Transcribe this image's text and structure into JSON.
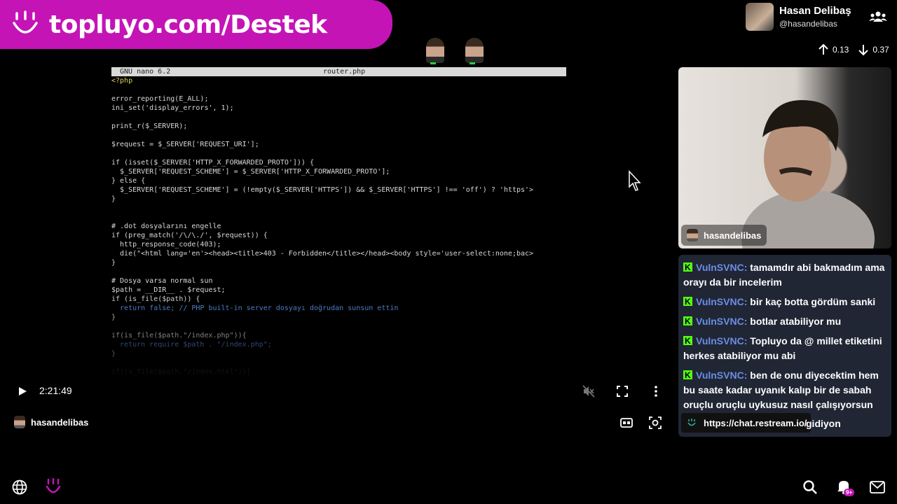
{
  "banner": {
    "text": "topluyo.com/Destek"
  },
  "terminal": {
    "editor": "GNU nano 6.2",
    "filename": "router.php",
    "lines": [
      {
        "t": "<?php",
        "c": "str"
      },
      {
        "t": "",
        "c": ""
      },
      {
        "t": "error_reporting(E_ALL);",
        "c": ""
      },
      {
        "t": "ini_set('display_errors', 1);",
        "c": ""
      },
      {
        "t": "",
        "c": ""
      },
      {
        "t": "print_r($_SERVER);",
        "c": ""
      },
      {
        "t": "",
        "c": ""
      },
      {
        "t": "$request = $_SERVER['REQUEST_URI'];",
        "c": ""
      },
      {
        "t": "",
        "c": ""
      },
      {
        "t": "if (isset($_SERVER['HTTP_X_FORWARDED_PROTO'])) {",
        "c": ""
      },
      {
        "t": "  $_SERVER['REQUEST_SCHEME'] = $_SERVER['HTTP_X_FORWARDED_PROTO'];",
        "c": ""
      },
      {
        "t": "} else {",
        "c": ""
      },
      {
        "t": "  $_SERVER['REQUEST_SCHEME'] = (!empty($_SERVER['HTTPS']) && $_SERVER['HTTPS'] !== 'off') ? 'https'>",
        "c": ""
      },
      {
        "t": "}",
        "c": ""
      },
      {
        "t": "",
        "c": ""
      },
      {
        "t": "",
        "c": ""
      },
      {
        "t": "# .dot dosyalarını engelle",
        "c": ""
      },
      {
        "t": "if (preg_match('/\\/\\./', $request)) {",
        "c": ""
      },
      {
        "t": "  http_response_code(403);",
        "c": ""
      },
      {
        "t": "  die(\"<html lang='en'><head><title>403 - Forbidden</title></head><body style='user-select:none;bac>",
        "c": ""
      },
      {
        "t": "}",
        "c": ""
      },
      {
        "t": "",
        "c": ""
      },
      {
        "t": "# Dosya varsa normal sun",
        "c": ""
      },
      {
        "t": "$path = __DIR__ . $request;",
        "c": ""
      },
      {
        "t": "if (is_file($path)) {",
        "c": ""
      },
      {
        "t": "  return false; // PHP built-in server dosyayı doğrudan sunsun ettin",
        "c": "kw"
      },
      {
        "t": "}",
        "c": ""
      },
      {
        "t": "",
        "c": ""
      },
      {
        "t": "if(is_file($path.\"/index.php\")){",
        "c": ""
      },
      {
        "t": "  return require $path . \"/index.php\";",
        "c": "kw"
      },
      {
        "t": "}",
        "c": ""
      },
      {
        "t": "",
        "c": ""
      },
      {
        "t": "if(is_file($path.\"/index.html\")){",
        "c": "dim"
      }
    ]
  },
  "player": {
    "time": "2:21:49",
    "channel": "hasandelibas"
  },
  "profile": {
    "name": "Hasan Delibaş",
    "handle": "@hasandelibas"
  },
  "stats": {
    "up": "0.13",
    "down": "0.37"
  },
  "cam": {
    "label": "hasandelibas"
  },
  "chat": {
    "messages": [
      {
        "user": "VulnSVNC:",
        "text": " tamamdır abi bakmadım ama orayı da bir incelerim"
      },
      {
        "user": "VulnSVNC:",
        "text": " bir kaç botta gördüm sanki"
      },
      {
        "user": "VulnSVNC:",
        "text": " botlar atabiliyor mu"
      },
      {
        "user": "VulnSVNC:",
        "text": " Topluyo da @ millet etiketini herkes atabiliyor mu abi"
      },
      {
        "user": "VulnSVNC:",
        "text": " ben de onu diyecektim hem bu saate kadar uyanık kalıp bir de sabah oruçlu oruçlu uykusuz nasıl çalışıyorsun"
      }
    ],
    "url": "https://chat.restream.io/",
    "tail": "gidiyon"
  },
  "notifications": {
    "badge": "9+"
  },
  "colors": {
    "accent": "#c414b6",
    "kick": "#53fc18",
    "chat_user": "#6b8de6",
    "chat_bg": "#202634"
  }
}
